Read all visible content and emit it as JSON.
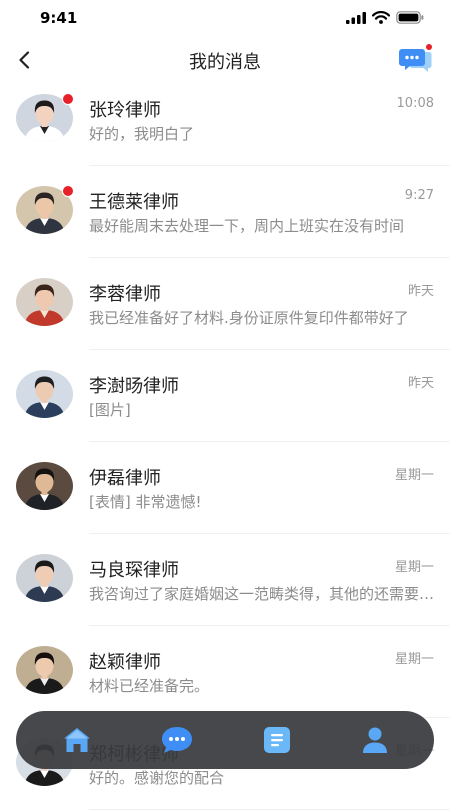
{
  "status_bar": {
    "time": "9:41"
  },
  "header": {
    "title": "我的消息"
  },
  "messages": [
    {
      "name": "张玲律师",
      "time": "10:08",
      "preview": "好的，我明白了",
      "unread": true
    },
    {
      "name": "王德莱律师",
      "time": "9:27",
      "preview": "最好能周末去处理一下，周内上班实在没有时间",
      "unread": true
    },
    {
      "name": "李蓉律师",
      "time": "昨天",
      "preview": "我已经准备好了材料.身份证原件复印件都带好了",
      "unread": false
    },
    {
      "name": "李澍旸律师",
      "time": "昨天",
      "preview": "[图片]",
      "unread": false
    },
    {
      "name": "伊磊律师",
      "time": "星期一",
      "preview": "[表情] 非常遗憾!",
      "unread": false
    },
    {
      "name": "马良琛律师",
      "time": "星期一",
      "preview": "我咨询过了家庭婚姻这一范畴类得，其他的还需要再确认",
      "unread": false
    },
    {
      "name": "赵颖律师",
      "time": "星期一",
      "preview": "材料已经准备完。",
      "unread": false
    },
    {
      "name": "郑柯彬律师",
      "time": "星期一",
      "preview": "好的。感谢您的配合",
      "unread": false
    }
  ],
  "tab_bar": {
    "tabs": [
      {
        "icon": "home-icon",
        "active": false
      },
      {
        "icon": "chat-bubble-icon",
        "active": true
      },
      {
        "icon": "document-icon",
        "active": false
      },
      {
        "icon": "user-icon",
        "active": false
      }
    ]
  },
  "colors": {
    "accent": "#3f8ef5",
    "unread_dot": "#e8202a",
    "tab_bar_bg": "#383a3d"
  }
}
